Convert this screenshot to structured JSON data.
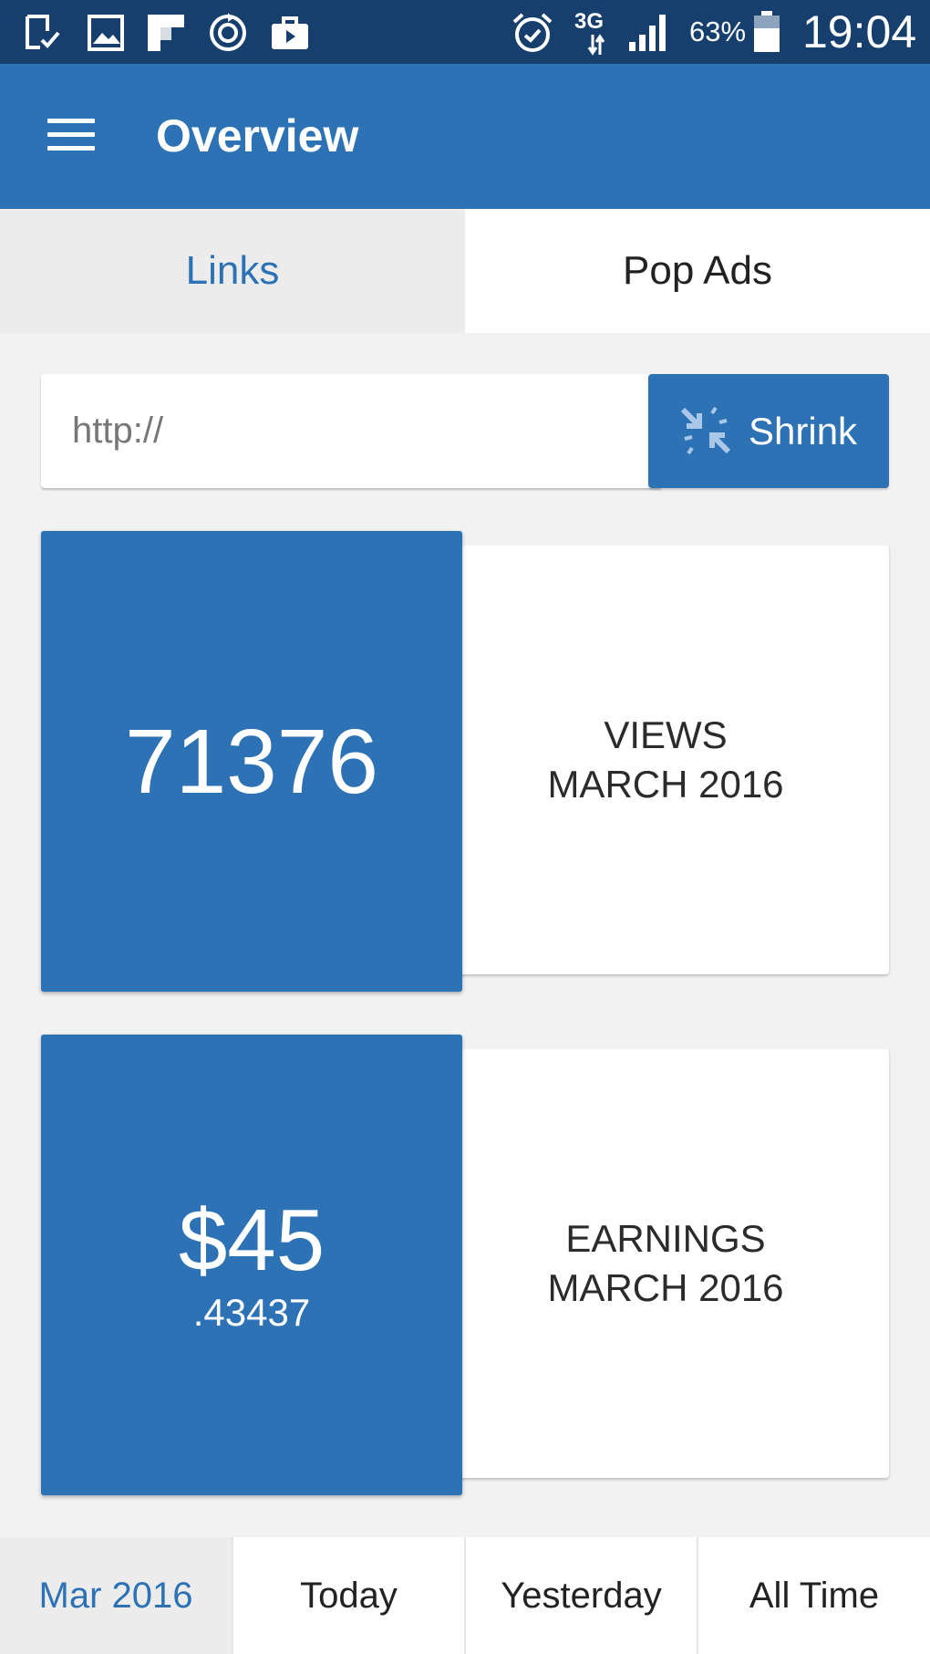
{
  "status_bar": {
    "left_icons": [
      "download-done-icon",
      "gallery-icon",
      "flipboard-icon",
      "sync-icon",
      "briefcase-play-icon"
    ],
    "alarm_icon": "alarm-icon",
    "network_type": "3G",
    "signal_icon": "signal-icon",
    "battery_percent": "63%",
    "battery_icon": "battery-icon",
    "time": "19:04"
  },
  "app_bar": {
    "menu_icon": "hamburger-menu-icon",
    "title": "Overview"
  },
  "tabs": [
    {
      "label": "Links",
      "active": true
    },
    {
      "label": "Pop Ads",
      "active": false
    }
  ],
  "shortener": {
    "placeholder": "http://",
    "button_label": "Shrink",
    "button_icon": "shrink-arrows-icon"
  },
  "stats": {
    "views": {
      "value": "71376",
      "label": "VIEWS",
      "period": "MARCH 2016"
    },
    "earnings": {
      "value_main": "$45",
      "value_decimals": ".43437",
      "label": "EARNINGS",
      "period": "MARCH 2016"
    }
  },
  "periods": [
    {
      "label": "Mar 2016",
      "active": true
    },
    {
      "label": "Today",
      "active": false
    },
    {
      "label": "Yesterday",
      "active": false
    },
    {
      "label": "All Time",
      "active": false
    }
  ],
  "colors": {
    "status_bar": "#173f6e",
    "primary": "#2d72b5",
    "background": "#f2f2f2",
    "active_tab_bg": "#ececec"
  }
}
